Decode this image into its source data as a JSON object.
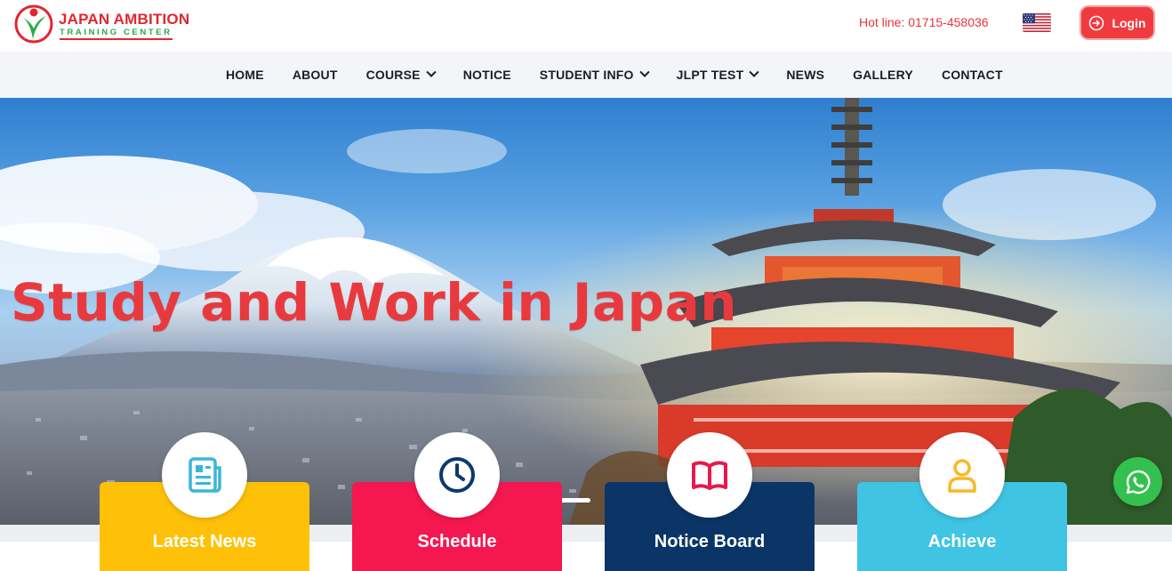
{
  "header": {
    "logo_title": "JAPAN AMBITION",
    "logo_subtitle": "TRAINING CENTER",
    "hotline": "Hot line: 01715-458036",
    "language_flag": "us-flag-icon",
    "login_label": "Login",
    "login_icon": "login-icon"
  },
  "nav": {
    "items": [
      {
        "label": "HOME",
        "dropdown": false
      },
      {
        "label": "ABOUT",
        "dropdown": false
      },
      {
        "label": "COURSE",
        "dropdown": true
      },
      {
        "label": "NOTICE",
        "dropdown": false
      },
      {
        "label": "STUDENT INFO",
        "dropdown": true
      },
      {
        "label": "JLPT TEST",
        "dropdown": true
      },
      {
        "label": "NEWS",
        "dropdown": false
      },
      {
        "label": "GALLERY",
        "dropdown": false
      },
      {
        "label": "CONTACT",
        "dropdown": false
      }
    ]
  },
  "hero": {
    "title": "Study and Work in Japan",
    "slides": 2,
    "active_slide": 1
  },
  "cards": [
    {
      "label": "Latest News",
      "icon": "news-icon",
      "color": "#ffc107",
      "icon_color": "#3ab7d8"
    },
    {
      "label": "Schedule",
      "icon": "clock-icon",
      "color": "#f5174f",
      "icon_color": "#0b3a6b"
    },
    {
      "label": "Notice Board",
      "icon": "book-icon",
      "color": "#0b3566",
      "icon_color": "#e8194d"
    },
    {
      "label": "Achieve",
      "icon": "user-icon",
      "color": "#40c4e4",
      "icon_color": "#f9b823"
    }
  ],
  "colors": {
    "brand_red": "#e8343c",
    "brand_green": "#2ea84a",
    "nav_bg": "#f3f5f8",
    "whatsapp": "#33c04f"
  },
  "floating": {
    "whatsapp_icon": "whatsapp-icon"
  }
}
